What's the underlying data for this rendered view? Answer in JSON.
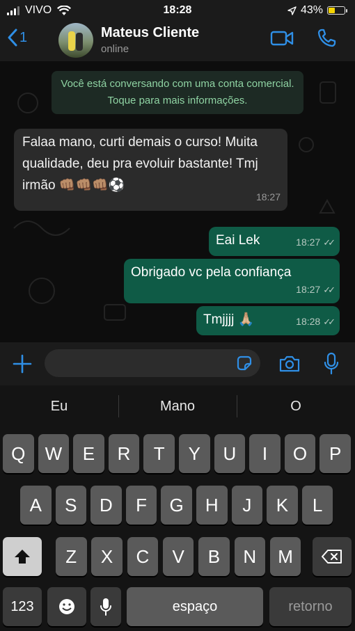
{
  "status_bar": {
    "carrier": "VIVO",
    "time": "18:28",
    "battery_percent": "43%",
    "battery_level": 0.43
  },
  "header": {
    "back_count": "1",
    "contact_name": "Mateus Cliente",
    "status": "online"
  },
  "chat": {
    "notice": "Você está conversando com uma conta comercial. Toque para mais informações.",
    "messages": [
      {
        "direction": "incoming",
        "text": "Falaa mano, curti demais o curso! Muita qualidade, deu pra evoluir bastante! Tmj irmão 👊🏽👊🏽👊🏽⚽",
        "time": "18:27"
      },
      {
        "direction": "outgoing",
        "text": "Eai Lek",
        "time": "18:27"
      },
      {
        "direction": "outgoing",
        "text": "Obrigado vc pela confiança",
        "time": "18:27"
      },
      {
        "direction": "outgoing",
        "text": "Tmjjjj 🙏🏼",
        "time": "18:28"
      }
    ]
  },
  "composer": {
    "placeholder": ""
  },
  "keyboard": {
    "suggestions": [
      "Eu",
      "Mano",
      "O"
    ],
    "row1": [
      "Q",
      "W",
      "E",
      "R",
      "T",
      "Y",
      "U",
      "I",
      "O",
      "P"
    ],
    "row2": [
      "A",
      "S",
      "D",
      "F",
      "G",
      "H",
      "J",
      "K",
      "L"
    ],
    "row3": [
      "Z",
      "X",
      "C",
      "V",
      "B",
      "N",
      "M"
    ],
    "numbers_key": "123",
    "space_key": "espaço",
    "return_key": "retorno"
  },
  "colors": {
    "accent": "#2f8fe6",
    "outgoing_bubble": "#0f5b46",
    "incoming_bubble": "#2b2b2b",
    "notice_text": "#8fd3a3"
  }
}
